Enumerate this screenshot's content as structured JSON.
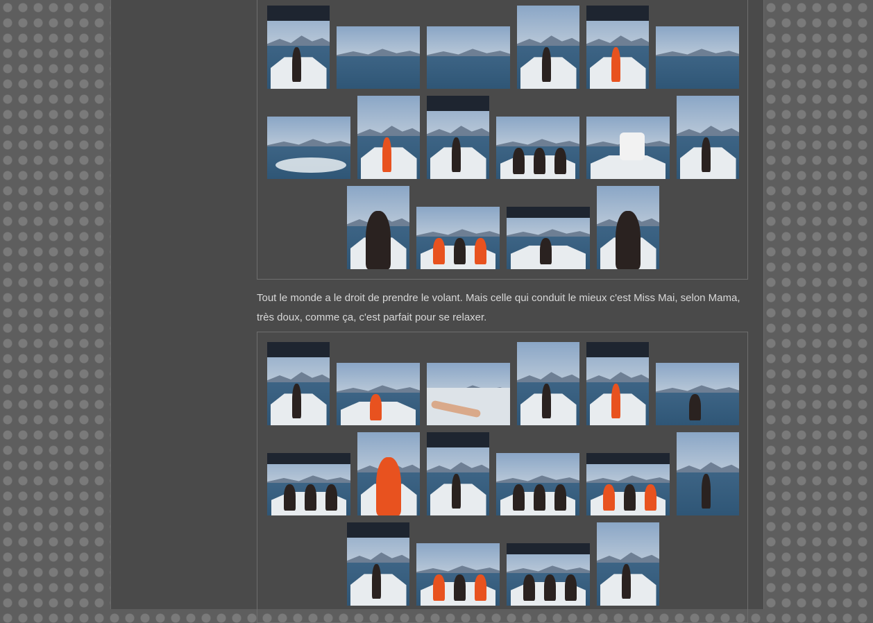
{
  "caption": "Tout le monde a le droit de prendre le volant. Mais celle qui conduit le mieux c'est Miss Mai, selon Mama, très doux, comme ça, c'est parfait pour se relaxer.",
  "colors": {
    "sky": "#9fb4cc",
    "hill": "#6e7f94",
    "water": "#2f5676",
    "life_vest": "#e8521f",
    "swimsuit": "#2a2220"
  },
  "gallery_1_photos": 16,
  "gallery_2_photos": 16
}
